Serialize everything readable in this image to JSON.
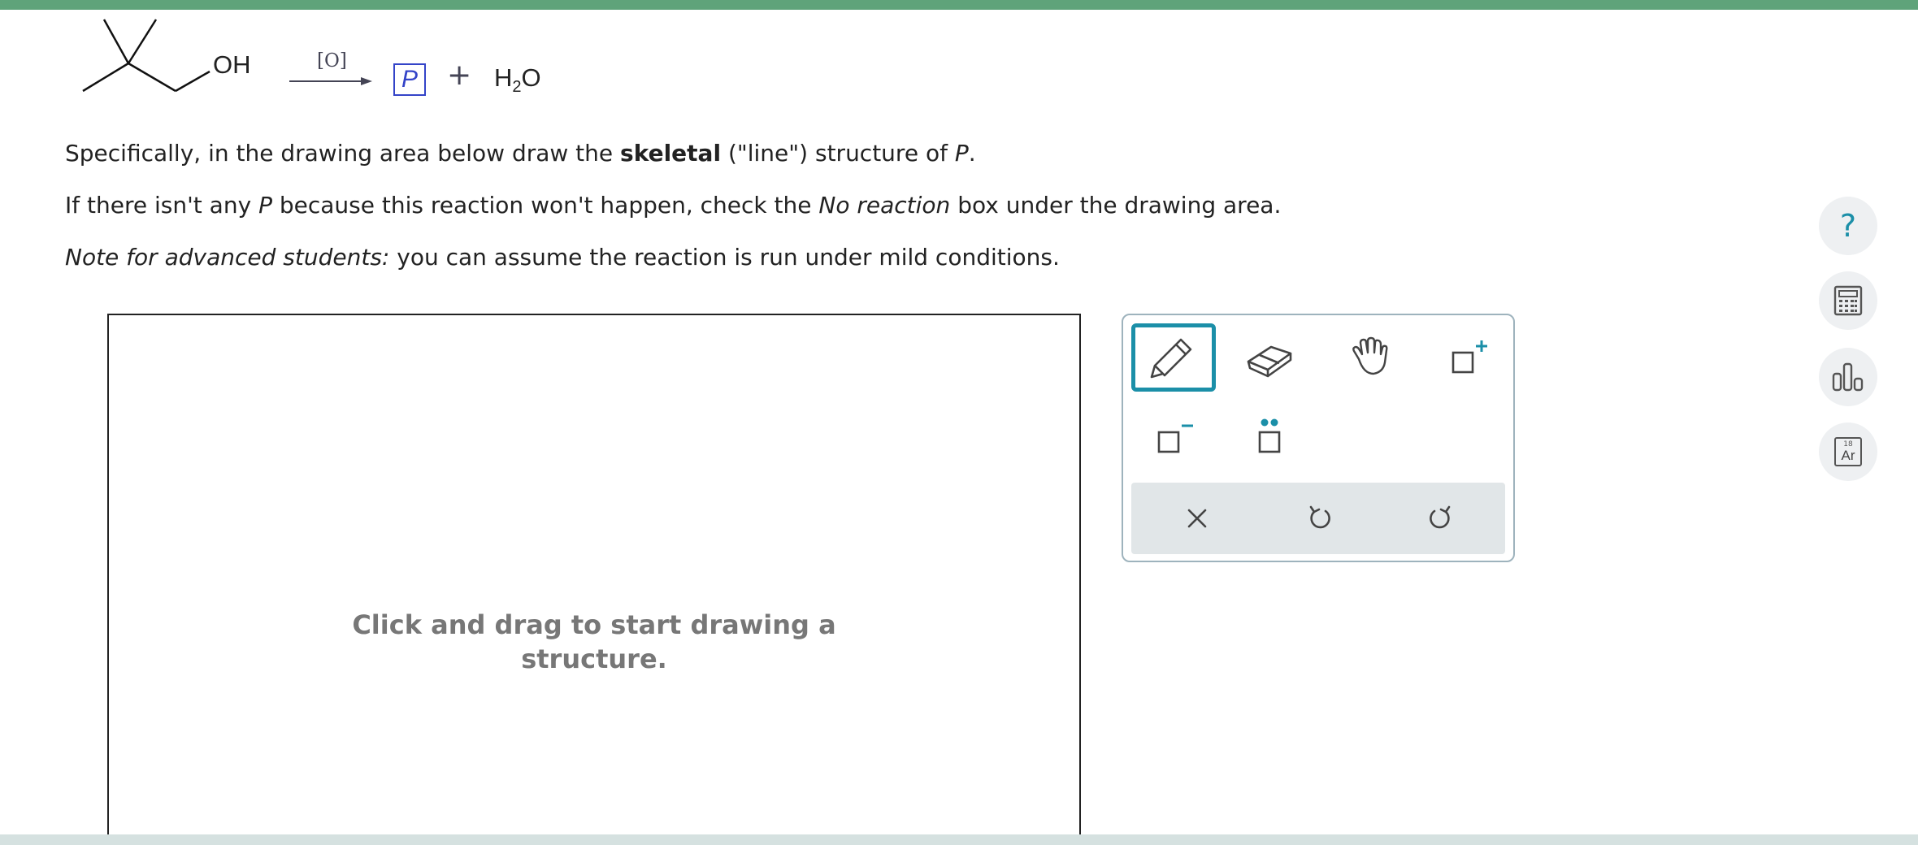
{
  "reaction": {
    "oh_label": "OH",
    "reagent": "[O]",
    "product_label": "P",
    "plus": "+",
    "water_h": "H",
    "water_sub": "2",
    "water_o": "O"
  },
  "instructions": {
    "line1_a": "Specifically, in the drawing area below draw the ",
    "line1_bold": "skeletal",
    "line1_b": " (\"line\") structure of ",
    "line1_p": "P",
    "line1_end": ".",
    "line2_a": "If there isn't any ",
    "line2_p": "P",
    "line2_b": " because this reaction won't happen, check the ",
    "line2_em": "No reaction",
    "line2_c": " box under the drawing area.",
    "line3_em": "Note for advanced students:",
    "line3_b": " you can assume the reaction is run under mild conditions."
  },
  "canvas": {
    "hint_line1": "Click and drag to start drawing a",
    "hint_line2": "structure."
  },
  "toolbox": {
    "tools": [
      "pencil-icon",
      "eraser-icon",
      "hand-icon",
      "add-charge-icon",
      "remove-charge-icon",
      "lone-pair-icon"
    ],
    "actions": [
      "clear-icon",
      "undo-icon",
      "redo-icon"
    ]
  },
  "sidebar": {
    "help": "?",
    "periodic_number": "18",
    "periodic_symbol": "Ar"
  },
  "colors": {
    "accent": "#1b8fa8",
    "top_bar": "#5fa37a",
    "product_box": "#3444c8"
  }
}
